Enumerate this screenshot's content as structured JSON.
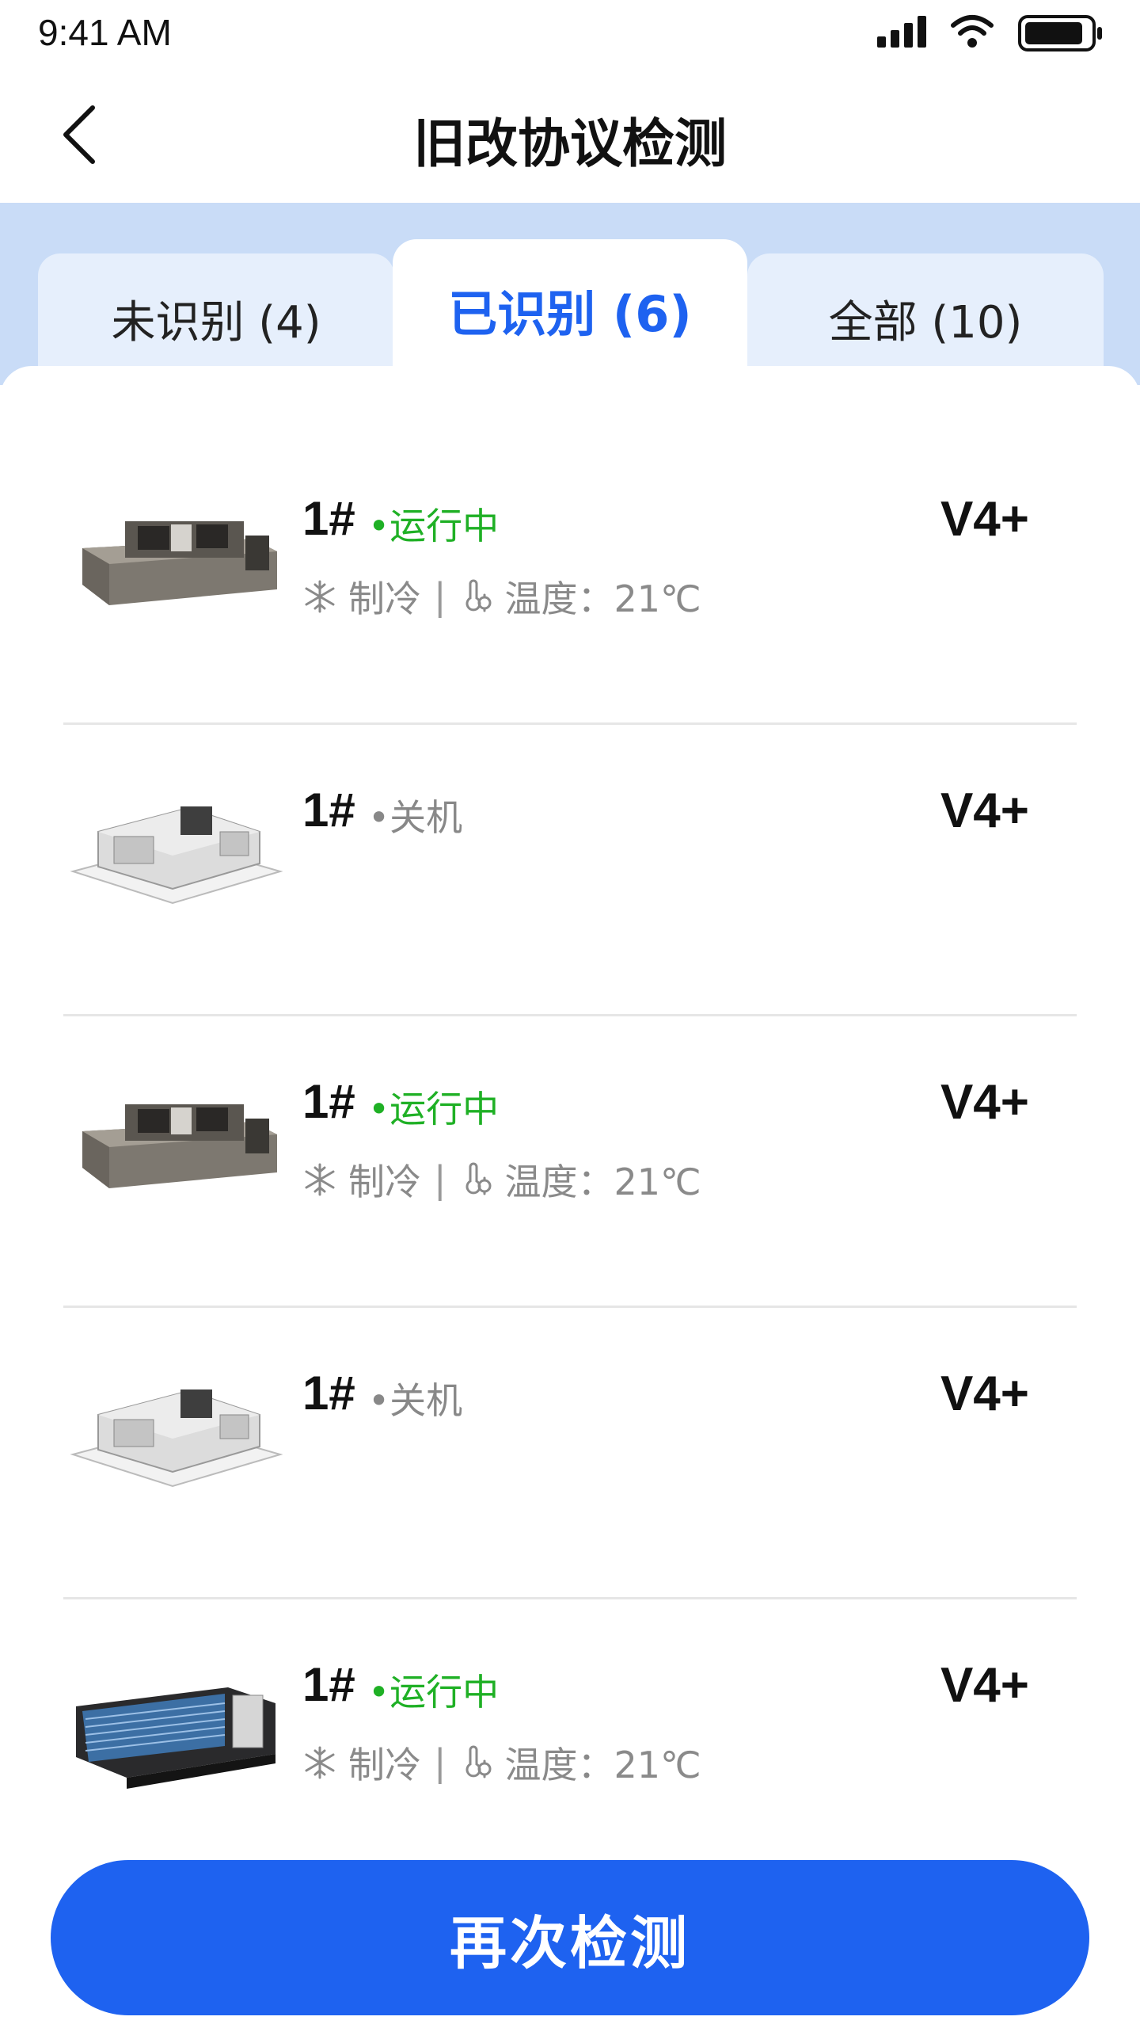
{
  "status_bar": {
    "time": "9:41 AM"
  },
  "nav": {
    "title": "旧改协议检测"
  },
  "tabs": [
    {
      "label": "未识别 (4)",
      "active": false
    },
    {
      "label": "已识别 (6)",
      "active": true
    },
    {
      "label": "全部 (10)",
      "active": false
    }
  ],
  "devices": [
    {
      "name": "1#",
      "status": "•运行中",
      "status_type": "running",
      "version": "V4+",
      "mode": "制冷",
      "temp_label": "温度：21℃",
      "image": "ducted-unit-icon"
    },
    {
      "name": "1#",
      "status": "•关机",
      "status_type": "off",
      "version": "V4+",
      "image": "cassette-unit-icon"
    },
    {
      "name": "1#",
      "status": "•运行中",
      "status_type": "running",
      "version": "V4+",
      "mode": "制冷",
      "temp_label": "温度：21℃",
      "image": "ducted-unit-icon"
    },
    {
      "name": "1#",
      "status": "•关机",
      "status_type": "off",
      "version": "V4+",
      "image": "cassette-unit-icon"
    },
    {
      "name": "1#",
      "status": "•运行中",
      "status_type": "running",
      "version": "V4+",
      "mode": "制冷",
      "temp_label": "温度：21℃",
      "image": "slim-duct-unit-icon"
    }
  ],
  "meta": {
    "separator": "|"
  },
  "action": {
    "label": "再次检测"
  },
  "colors": {
    "accent": "#1e62f0",
    "running": "#1fb025",
    "off": "#888888",
    "tab_band": "#c9dcf7"
  }
}
